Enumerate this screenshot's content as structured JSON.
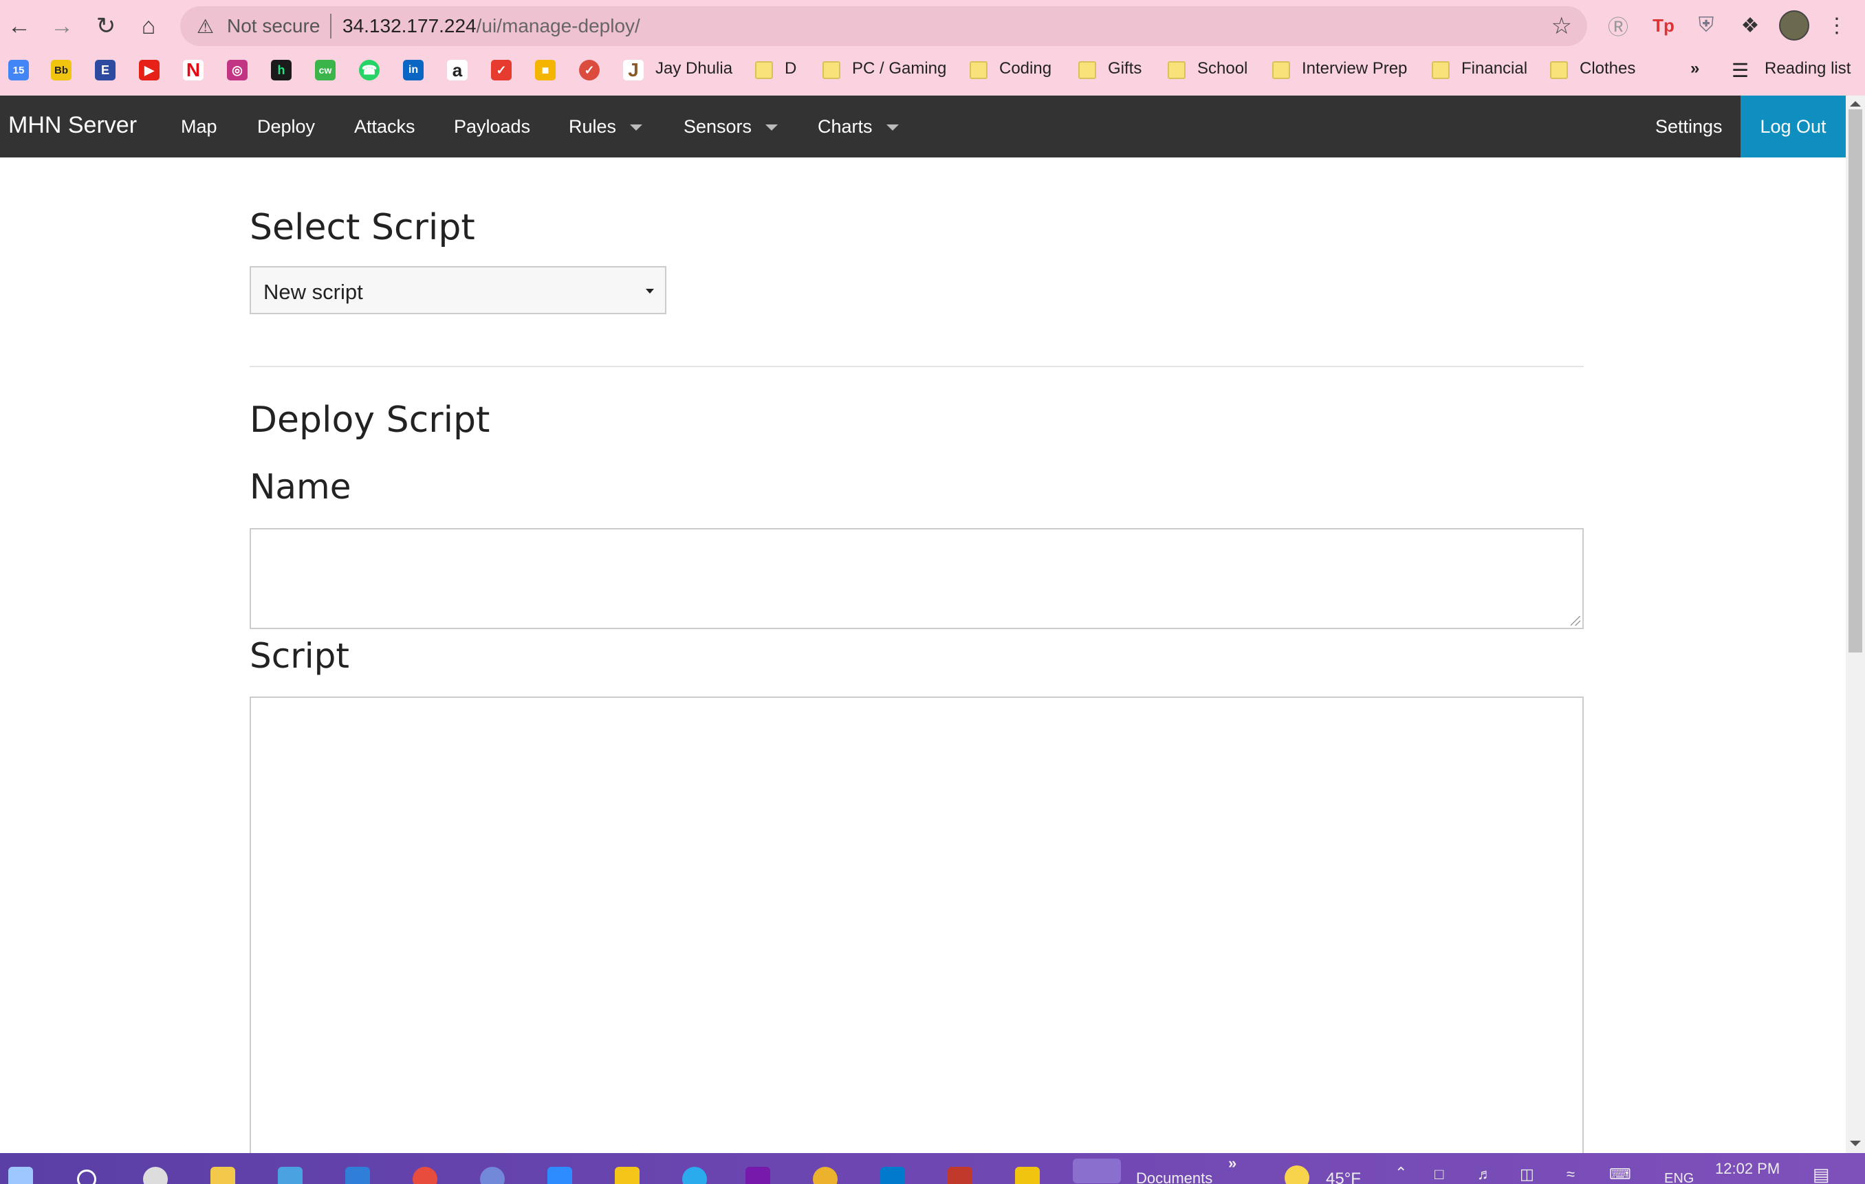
{
  "browser": {
    "security_label": "Not secure",
    "url_host": "34.132.177.224",
    "url_path": "/ui/manage-deploy/",
    "bookmarks": {
      "calendar_day": "15",
      "bb": "Bb",
      "jay_dhulia": "Jay Dhulia",
      "d": "D",
      "pc_gaming": "PC / Gaming",
      "coding": "Coding",
      "gifts": "Gifts",
      "school": "School",
      "interview_prep": "Interview Prep",
      "financial": "Financial",
      "clothes": "Clothes",
      "overflow": "»",
      "reading_list": "Reading list"
    }
  },
  "navbar": {
    "brand": "MHN Server",
    "items": {
      "map": "Map",
      "deploy": "Deploy",
      "attacks": "Attacks",
      "payloads": "Payloads",
      "rules": "Rules",
      "sensors": "Sensors",
      "charts": "Charts"
    },
    "settings": "Settings",
    "logout": "Log Out"
  },
  "page": {
    "select_title": "Select Script",
    "selected_script": "New script",
    "deploy_title": "Deploy Script",
    "name_label": "Name",
    "name_value": "",
    "script_label": "Script",
    "script_value": ""
  },
  "taskbar": {
    "documents": "Documents",
    "overflow": "»",
    "temperature": "45°F",
    "language": "ENG",
    "time": "12:02 PM"
  }
}
